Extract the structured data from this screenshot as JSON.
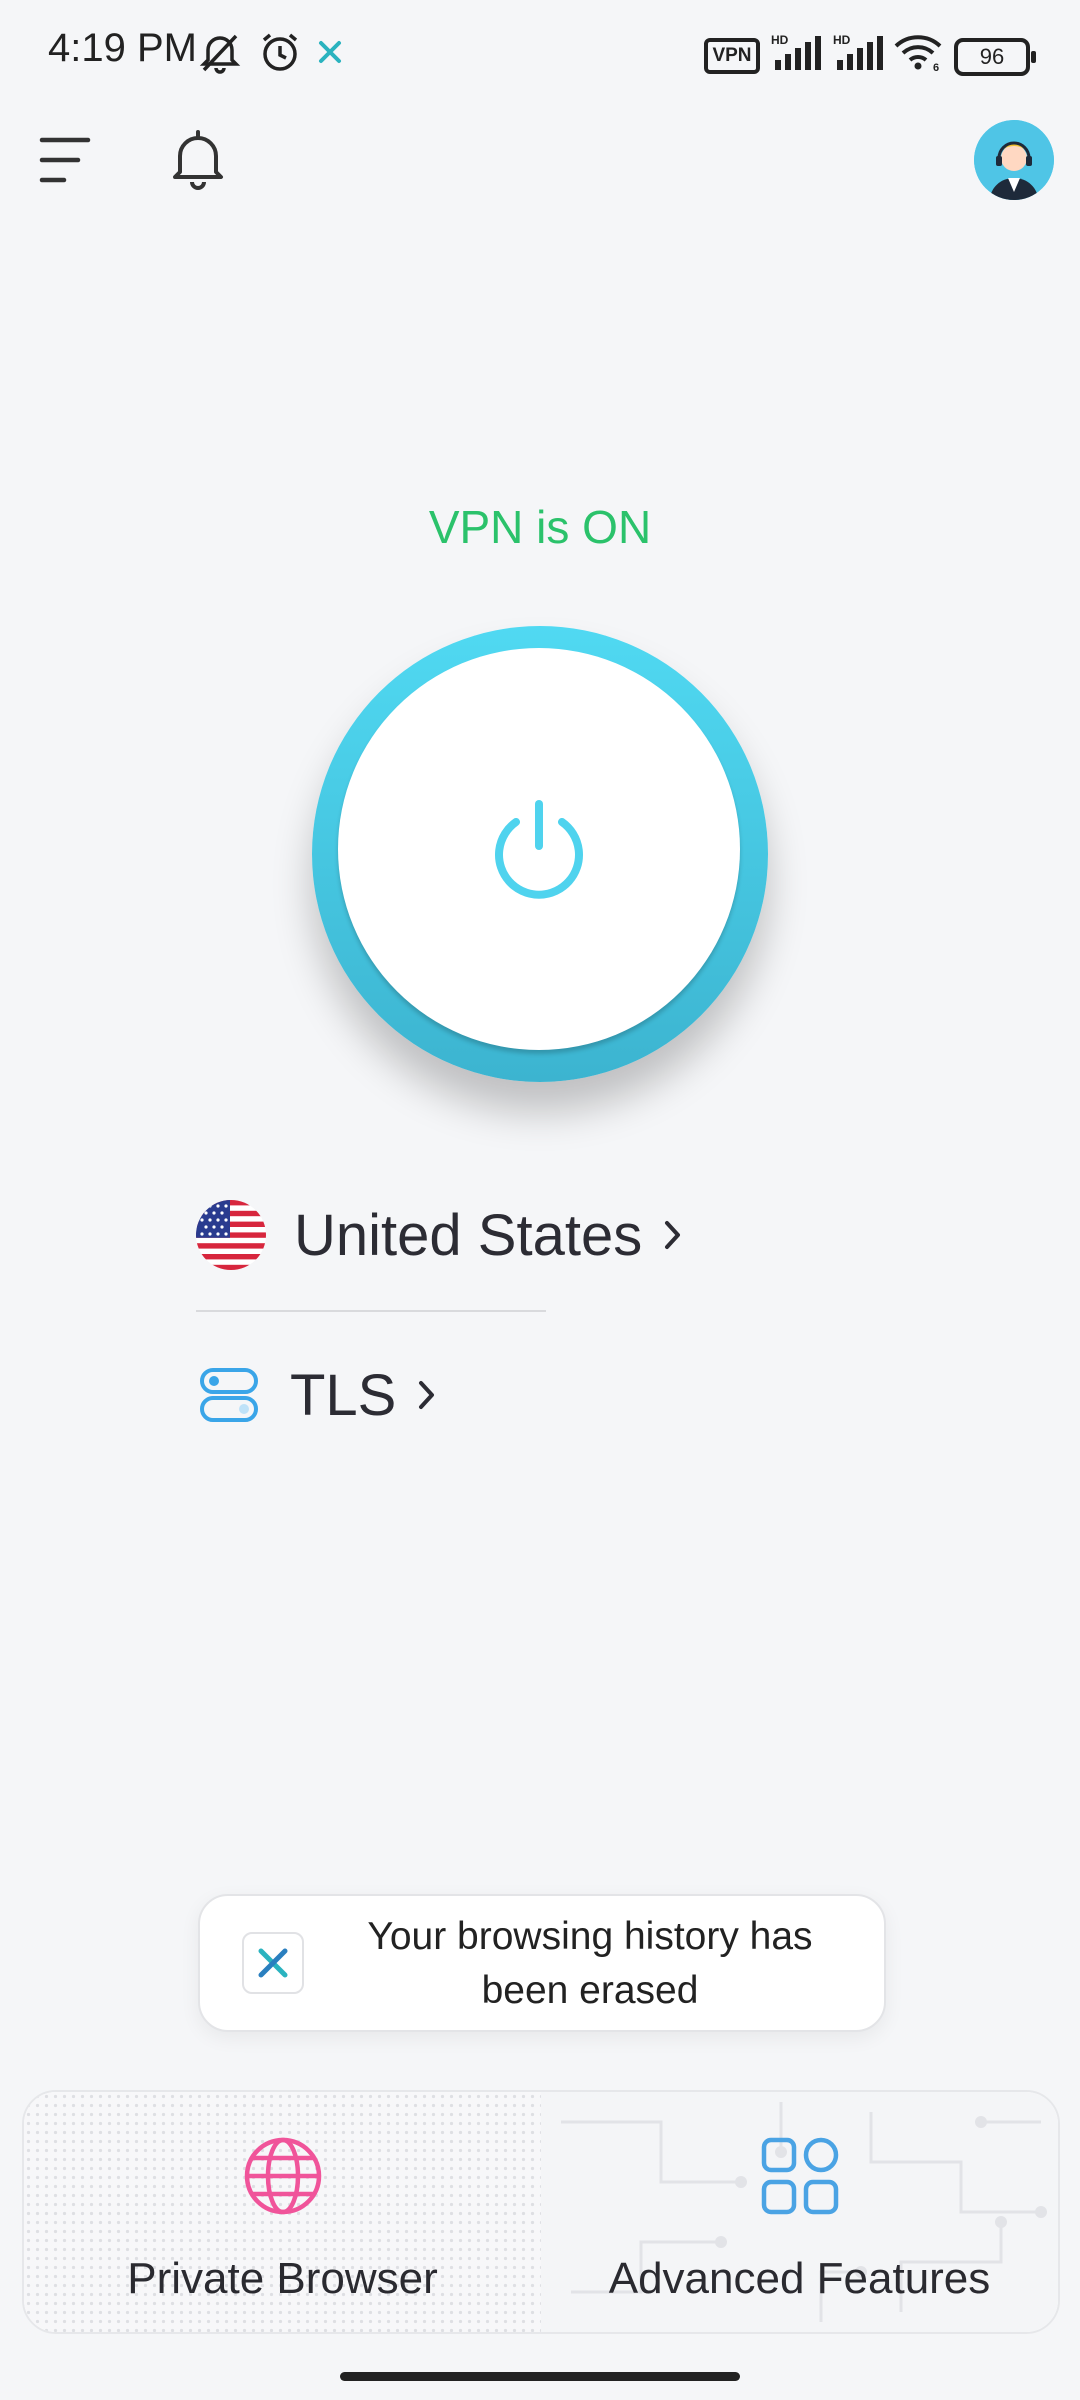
{
  "status_bar": {
    "time": "4:19 PM",
    "vpn_badge": "VPN",
    "battery": "96",
    "icons": [
      "mute-icon",
      "alarm-icon",
      "app-notification-icon",
      "vpn-icon",
      "signal-hd-icon",
      "signal-hd-icon",
      "wifi-icon",
      "battery-icon"
    ]
  },
  "top_bar": {
    "icons": [
      "menu-icon",
      "bell-icon",
      "support-avatar"
    ]
  },
  "vpn": {
    "status": "VPN is ON",
    "status_color": "#2bc26b",
    "accent_color": "#4fd3ee"
  },
  "location": {
    "country": "United States",
    "protocol": "TLS"
  },
  "toast": {
    "message": "Your browsing history has been erased"
  },
  "bottom_nav": {
    "items": [
      {
        "label": "Private Browser",
        "icon": "globe-icon",
        "color": "#f0549a"
      },
      {
        "label": "Advanced Features",
        "icon": "grid-icon",
        "color": "#4aa3e4"
      }
    ]
  }
}
